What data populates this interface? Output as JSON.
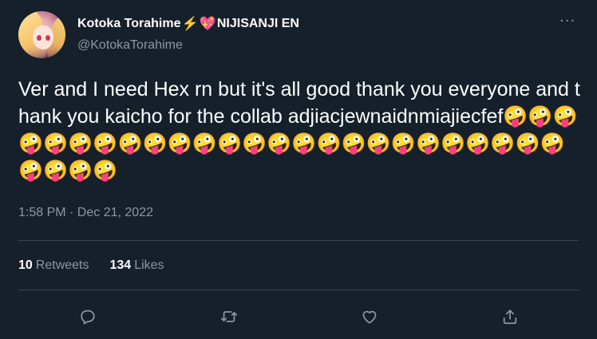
{
  "tweet": {
    "display_name": "Kotoka Torahime",
    "display_name_suffix": "NIJISANJI EN",
    "name_emojis": [
      "lightning-icon",
      "sparkling-heart-icon"
    ],
    "handle": "@KotokaTorahime",
    "more_glyph": "···",
    "text": "Ver and I need Hex rn but it's all good thank you everyone and thank you kaicho for the collab adjiacjewnaidnmiajiecfef🤪🤪🤪🤪🤪🤪🤪🤪🤪🤪🤪🤪🤪🤪🤪🤪🤪🤪🤪🤪🤪🤪🤪🤪🤪🤪🤪🤪🤪",
    "timestamp": "1:58 PM · Dec 21, 2022",
    "retweets_count": "10",
    "retweets_label": "Retweets",
    "likes_count": "134",
    "likes_label": "Likes"
  },
  "actions": [
    {
      "icon": "reply-icon"
    },
    {
      "icon": "retweet-icon"
    },
    {
      "icon": "like-icon"
    },
    {
      "icon": "share-icon"
    }
  ],
  "colors": {
    "background": "#15202b",
    "text": "#ffffff",
    "secondary": "#8b98a5",
    "divider": "#38444d"
  }
}
